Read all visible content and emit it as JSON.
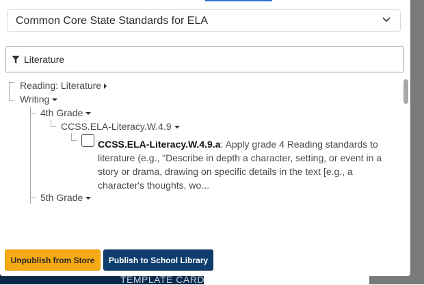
{
  "framework_select": {
    "value": "Common Core State Standards for ELA",
    "icon": "chevron-down-icon"
  },
  "filter": {
    "value": "Literature",
    "icon": "filter-icon"
  },
  "tree": {
    "reading_literature": "Reading: Literature",
    "writing": "Writing",
    "grade_4": "4th Grade",
    "standard_group": "CCSS.ELA-Literacy.W.4.9",
    "standard": {
      "code": "CCSS.ELA-Literacy.W.4.9.a",
      "sep": ":",
      "description": " Apply grade 4 Reading standards to literature (e.g., \"Describe in depth a character, setting, or event in a story or drama, drawing on specific details in the text [e.g., a character's thoughts, wo..."
    },
    "grade_5": "5th Grade"
  },
  "buttons": {
    "unpublish": "Unpublish from Store",
    "publish": "Publish to School Library"
  },
  "background": {
    "card_label": "TEMPLATE CARD"
  },
  "colors": {
    "accent": "#2b72d9",
    "unpublish_bg": "#f5a912",
    "publish_bg": "#0f3e6e",
    "backdrop_dark": "#0d2a4a"
  }
}
